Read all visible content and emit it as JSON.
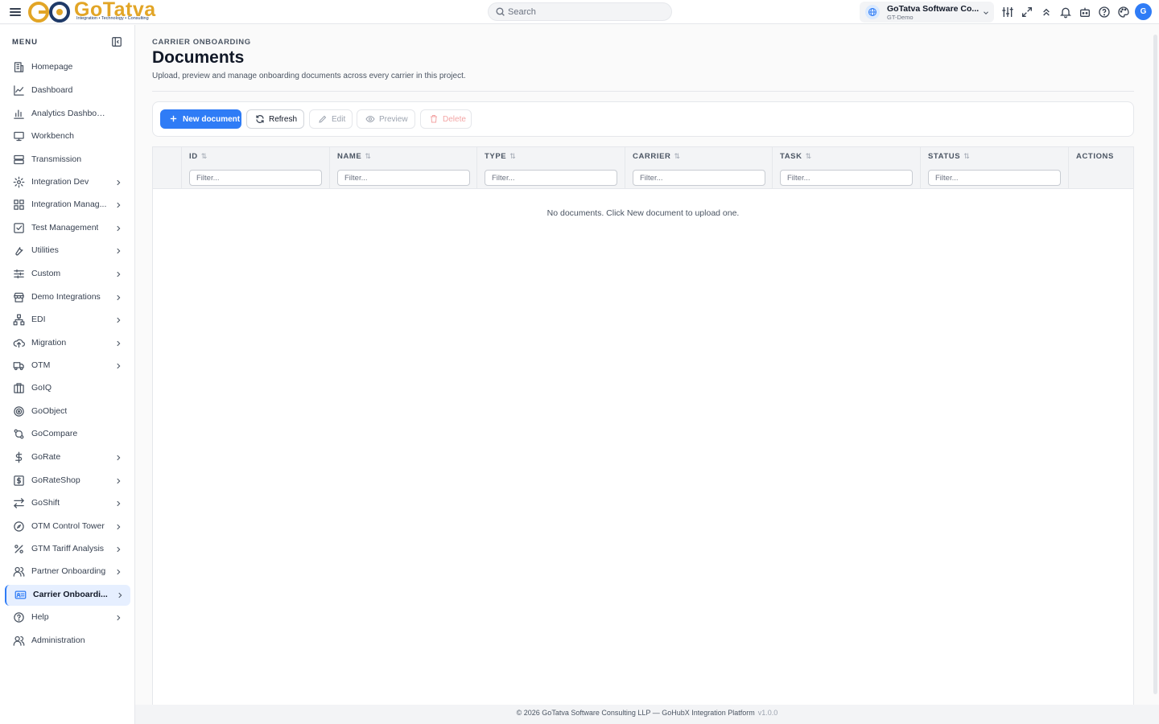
{
  "header": {
    "logo": {
      "word": "GoTatva",
      "tagline": "Integration • Technology • Consulting"
    },
    "search_placeholder": "Search",
    "org": {
      "name": "GoTatva Software Co...",
      "sub": "GT-Demo"
    },
    "icons": [
      "sliders-icon",
      "expand-icon",
      "chevrons-up-icon",
      "bell-icon",
      "robot-icon",
      "help-icon",
      "palette-icon"
    ],
    "avatar_initial": "G"
  },
  "sidebar": {
    "title": "MENU",
    "items": [
      {
        "label": "Homepage",
        "icon": "building-icon",
        "has_children": false
      },
      {
        "label": "Dashboard",
        "icon": "line-chart-icon",
        "has_children": false
      },
      {
        "label": "Analytics Dashboard",
        "icon": "bar-chart-icon",
        "has_children": false
      },
      {
        "label": "Workbench",
        "icon": "monitor-icon",
        "has_children": false
      },
      {
        "label": "Transmission",
        "icon": "server-icon",
        "has_children": false
      },
      {
        "label": "Integration Dev",
        "icon": "gear-icon",
        "has_children": true
      },
      {
        "label": "Integration Manag...",
        "icon": "grid-icon",
        "has_children": true
      },
      {
        "label": "Test Management",
        "icon": "checkbox-icon",
        "has_children": true
      },
      {
        "label": "Utilities",
        "icon": "wrench-icon",
        "has_children": true
      },
      {
        "label": "Custom",
        "icon": "sliders-h-icon",
        "has_children": true
      },
      {
        "label": "Demo Integrations",
        "icon": "store-icon",
        "has_children": true
      },
      {
        "label": "EDI",
        "icon": "network-icon",
        "has_children": true
      },
      {
        "label": "Migration",
        "icon": "cloud-upload-icon",
        "has_children": true
      },
      {
        "label": "OTM",
        "icon": "truck-icon",
        "has_children": true
      },
      {
        "label": "GoIQ",
        "icon": "columns-icon",
        "has_children": false
      },
      {
        "label": "GoObject",
        "icon": "target-icon",
        "has_children": false
      },
      {
        "label": "GoCompare",
        "icon": "compare-icon",
        "has_children": false
      },
      {
        "label": "GoRate",
        "icon": "dollar-icon",
        "has_children": true
      },
      {
        "label": "GoRateShop",
        "icon": "dollar-box-icon",
        "has_children": true
      },
      {
        "label": "GoShift",
        "icon": "arrows-swap-icon",
        "has_children": true
      },
      {
        "label": "OTM Control Tower",
        "icon": "compass-icon",
        "has_children": true
      },
      {
        "label": "GTM Tariff Analysis",
        "icon": "percent-icon",
        "has_children": true
      },
      {
        "label": "Partner Onboarding",
        "icon": "users-icon",
        "has_children": true
      },
      {
        "label": "Carrier Onboardi...",
        "icon": "id-card-icon",
        "has_children": true,
        "active": true
      },
      {
        "label": "Help",
        "icon": "help-circle-icon",
        "has_children": true
      },
      {
        "label": "Administration",
        "icon": "users-admin-icon",
        "has_children": false
      }
    ]
  },
  "main": {
    "breadcrumb": "CARRIER ONBOARDING",
    "title": "Documents",
    "subtitle": "Upload, preview and manage onboarding documents across every carrier in this project.",
    "toolbar": {
      "new_label": "New document",
      "refresh_label": "Refresh",
      "edit_label": "Edit",
      "preview_label": "Preview",
      "delete_label": "Delete"
    },
    "table": {
      "columns": [
        "ID",
        "NAME",
        "TYPE",
        "CARRIER",
        "TASK",
        "STATUS",
        "ACTIONS"
      ],
      "filter_placeholder": "Filter...",
      "empty_message": "No documents. Click New document to upload one."
    }
  },
  "footer": {
    "text": "© 2026 GoTatva Software Consulting LLP — GoHubX Integration Platform",
    "version": "v1.0.0"
  },
  "colors": {
    "accent": "#2f7cf6",
    "brand_gold": "#e2a526",
    "active_bg": "#e6efff"
  }
}
